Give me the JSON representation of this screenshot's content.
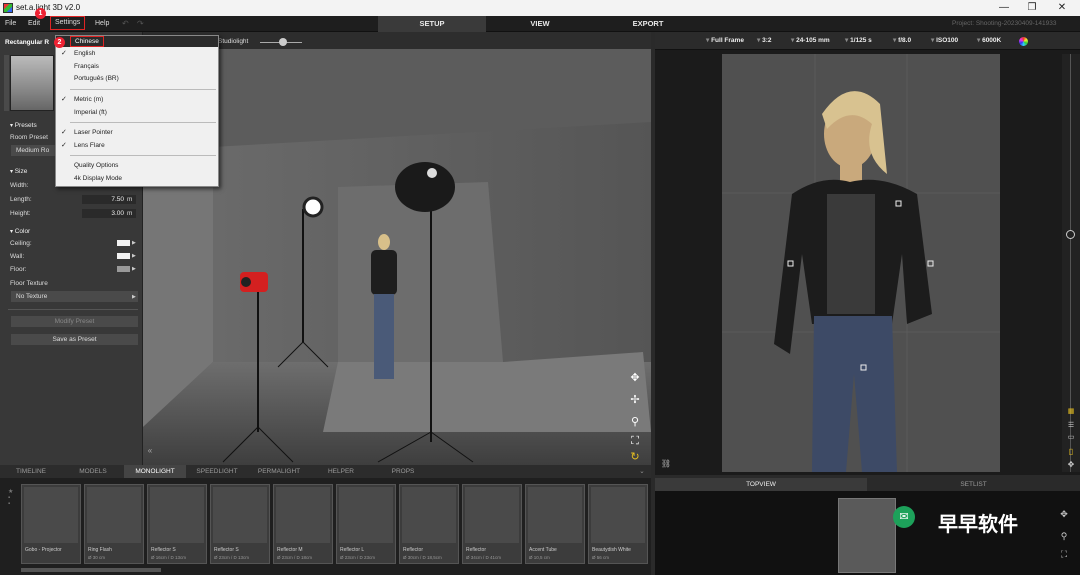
{
  "window": {
    "title": "set.a.light 3D v2.0",
    "minimize": "—",
    "maximize": "❐",
    "close": "✕"
  },
  "menu": {
    "file": "File",
    "edit": "Edit",
    "settings": "Settings",
    "help": "Help"
  },
  "top_tabs": {
    "setup": "SETUP",
    "view": "VIEW",
    "export": "EXPORT"
  },
  "project": "Project: Shooting-20230409-141933",
  "left_panel": {
    "header": "Rectangular R",
    "presets": "Presets",
    "room_preset_label": "Room Preset",
    "room_preset_value": "Medium Ro",
    "size": "Size",
    "width_label": "Width:",
    "length_label": "Length:",
    "length_value": "7.50",
    "height_label": "Height:",
    "height_value": "3.00",
    "unit": "m",
    "color": "Color",
    "ceiling": "Ceiling:",
    "wall": "Wall:",
    "floor": "Floor:",
    "floor_texture": "Floor Texture",
    "no_texture": "No Texture",
    "modify_preset": "Modify Preset",
    "save_preset": "Save as Preset"
  },
  "viewport": {
    "studiolight": "Studiolight"
  },
  "settings_menu": {
    "chinese": "Chinese",
    "english": "English",
    "francais": "Français",
    "portugues": "Português (BR)",
    "metric": "Metric (m)",
    "imperial": "Imperial (ft)",
    "laser": "Laser Pointer",
    "lens_flare": "Lens Flare",
    "quality": "Quality Options",
    "display4k": "4k Display Mode",
    "check": "✓"
  },
  "annotations": {
    "badge1": "1",
    "badge2": "2"
  },
  "camera": {
    "frame": "Full Frame",
    "ratio": "3:2",
    "lens": "24-105 mm",
    "shutter": "1/125 s",
    "aperture": "f/8.0",
    "iso": "ISO100",
    "wb": "6000K"
  },
  "bottom_tabs": [
    "TIMELINE",
    "MODELS",
    "MONOLIGHT",
    "SPEEDLIGHT",
    "PERMALIGHT",
    "HELPER",
    "PROPS"
  ],
  "lights": [
    {
      "name": "Gobo - Projector",
      "dim": ""
    },
    {
      "name": "Ring Flash",
      "dim": "Ø 30 cm"
    },
    {
      "name": "Reflector S",
      "dim": "Ø 16cm / D 13cm"
    },
    {
      "name": "Reflector S",
      "dim": "Ø 23cm / D 13cm"
    },
    {
      "name": "Reflector M",
      "dim": "Ø 23cm / D 18cm"
    },
    {
      "name": "Reflector L",
      "dim": "Ø 23cm / D 23cm"
    },
    {
      "name": "Reflector",
      "dim": "Ø 30cm / D 18,5cm"
    },
    {
      "name": "Reflector",
      "dim": "Ø 34cm / D 41cm"
    },
    {
      "name": "Accent Tube",
      "dim": "Ø 10,5 cm"
    },
    {
      "name": "Beautydish White",
      "dim": "Ø 56 cm"
    }
  ],
  "right_bottom_tabs": {
    "topview": "TOPVIEW",
    "setlist": "SETLIST"
  },
  "watermark": "早早软件",
  "colors": {
    "accent_red": "#e02424",
    "tab_active": "#3a3a3a",
    "panel": "#383838"
  }
}
